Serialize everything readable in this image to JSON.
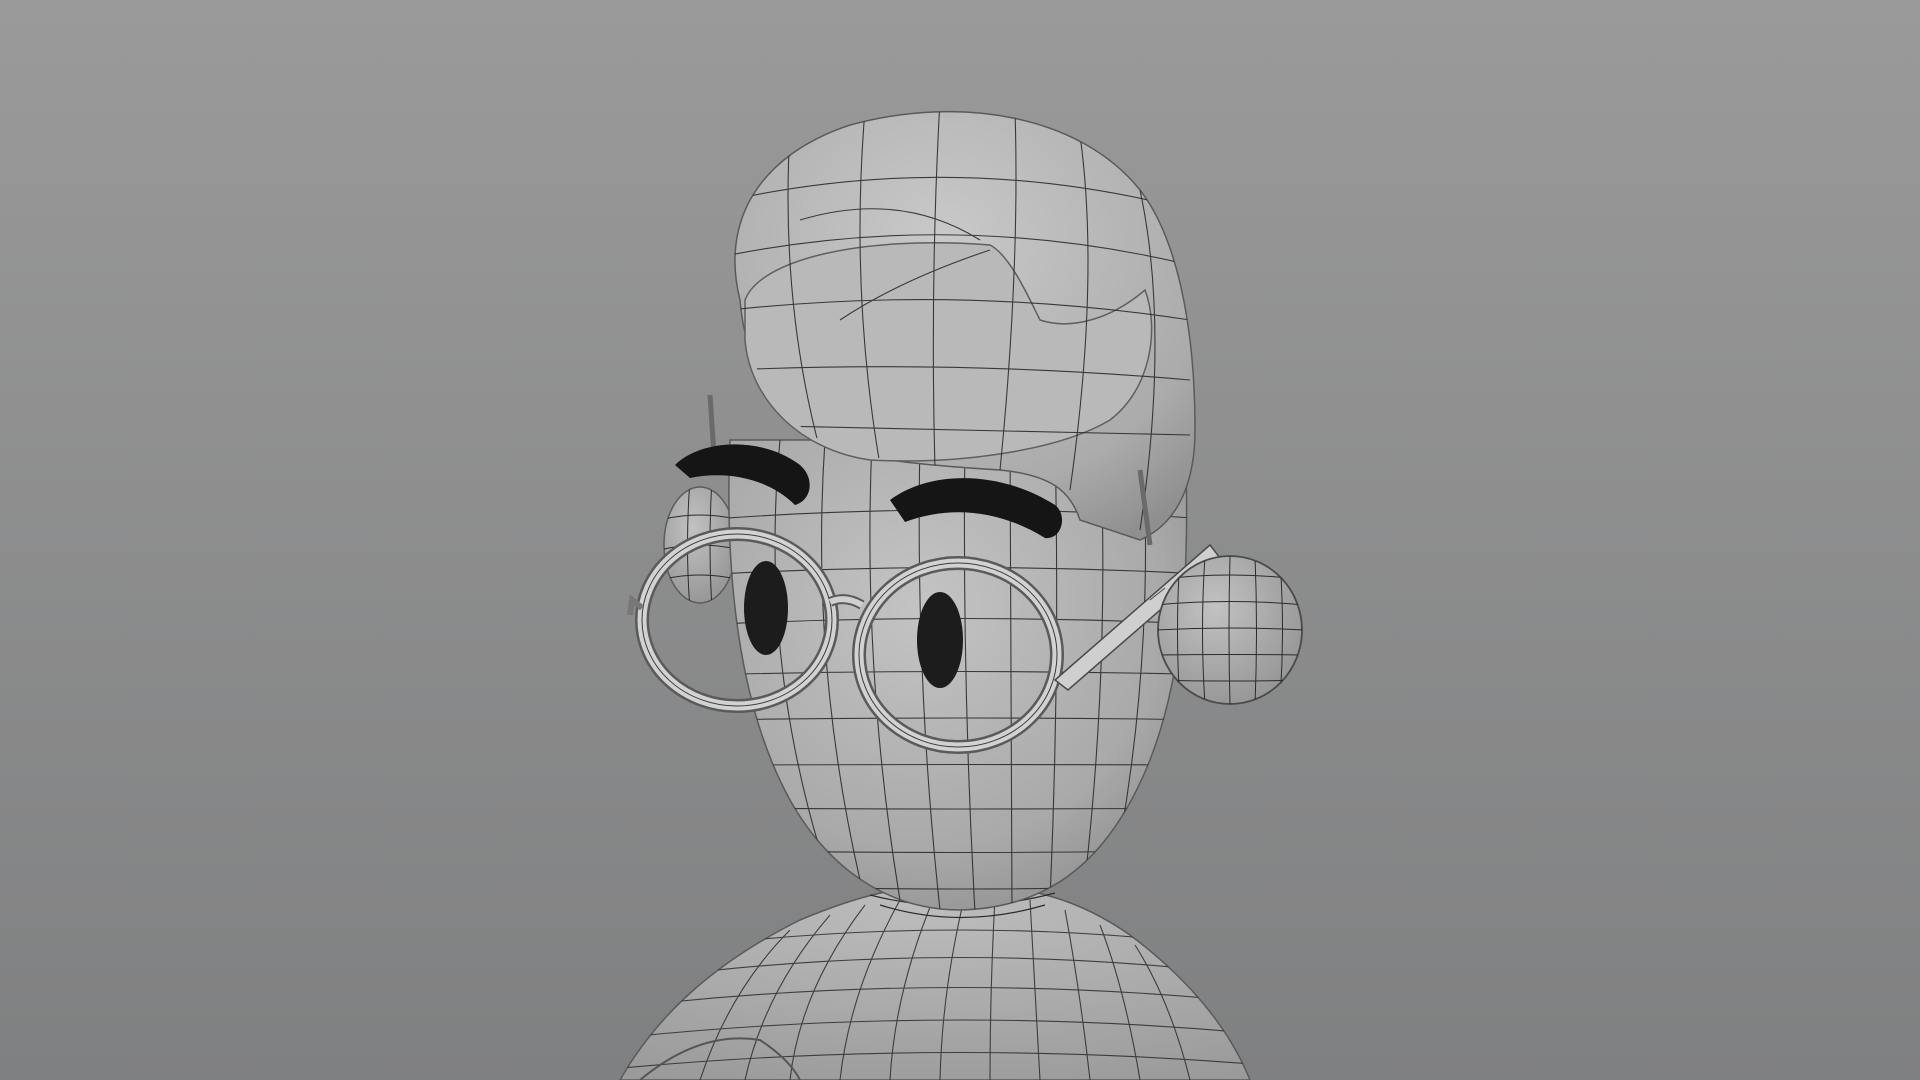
{
  "scene": {
    "background_top": "#9a9a9a",
    "background_bottom": "#7f8081",
    "mesh_color": "#b4b4b4",
    "wire_color": "#2b2b2b",
    "eye_color": "#1c1c1c",
    "brow_color": "#151515"
  }
}
